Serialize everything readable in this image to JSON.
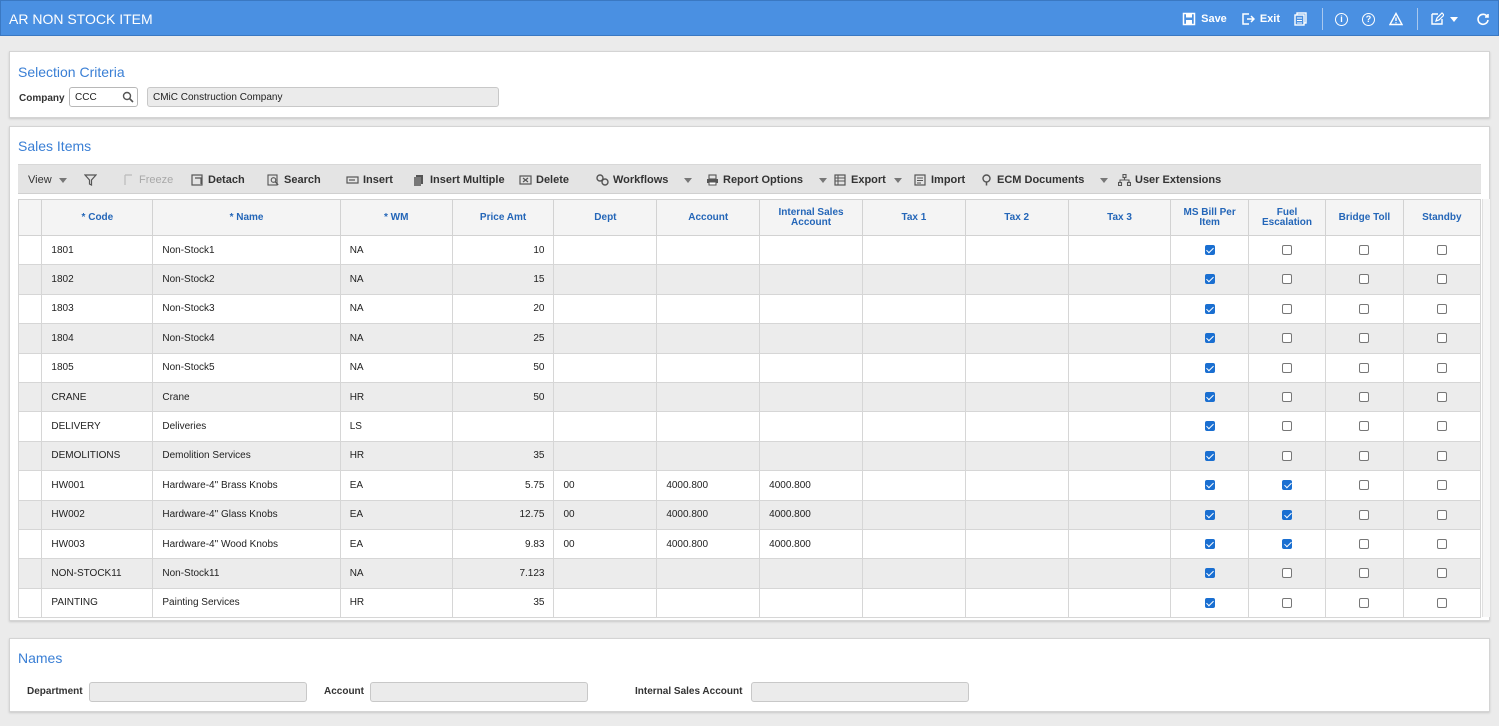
{
  "window": {
    "title": "AR NON STOCK ITEM"
  },
  "titlebar": {
    "save_label": "Save",
    "exit_label": "Exit"
  },
  "selection_criteria": {
    "title": "Selection Criteria",
    "company_label": "Company",
    "company_value": "CCC",
    "company_name": "CMiC Construction Company"
  },
  "sales_items": {
    "title": "Sales Items",
    "toolbar": {
      "view": "View",
      "freeze": "Freeze",
      "detach": "Detach",
      "search": "Search",
      "insert": "Insert",
      "insert_multiple": "Insert Multiple",
      "delete": "Delete",
      "workflows": "Workflows",
      "report_options": "Report Options",
      "export": "Export",
      "import": "Import",
      "ecm_documents": "ECM Documents",
      "user_extensions": "User Extensions"
    },
    "columns": {
      "code": "* Code",
      "name": "* Name",
      "wm": "* WM",
      "price_amt": "Price Amt",
      "dept": "Dept",
      "account": "Account",
      "internal_sales_account": "Internal Sales Account",
      "tax1": "Tax 1",
      "tax2": "Tax 2",
      "tax3": "Tax 3",
      "ms_bill_per_item": "MS Bill Per Item",
      "fuel_escalation": "Fuel Escalation",
      "bridge_toll": "Bridge Toll",
      "standby": "Standby"
    },
    "rows": [
      {
        "code": "1801",
        "name": "Non-Stock1",
        "wm": "NA",
        "price": "10",
        "dept": "",
        "account": "",
        "isa": "",
        "tax1": "",
        "tax2": "",
        "tax3": "",
        "ms": true,
        "fuel": false,
        "bridge": false,
        "standby": false
      },
      {
        "code": "1802",
        "name": "Non-Stock2",
        "wm": "NA",
        "price": "15",
        "dept": "",
        "account": "",
        "isa": "",
        "tax1": "",
        "tax2": "",
        "tax3": "",
        "ms": true,
        "fuel": false,
        "bridge": false,
        "standby": false
      },
      {
        "code": "1803",
        "name": "Non-Stock3",
        "wm": "NA",
        "price": "20",
        "dept": "",
        "account": "",
        "isa": "",
        "tax1": "",
        "tax2": "",
        "tax3": "",
        "ms": true,
        "fuel": false,
        "bridge": false,
        "standby": false
      },
      {
        "code": "1804",
        "name": "Non-Stock4",
        "wm": "NA",
        "price": "25",
        "dept": "",
        "account": "",
        "isa": "",
        "tax1": "",
        "tax2": "",
        "tax3": "",
        "ms": true,
        "fuel": false,
        "bridge": false,
        "standby": false
      },
      {
        "code": "1805",
        "name": "Non-Stock5",
        "wm": "NA",
        "price": "50",
        "dept": "",
        "account": "",
        "isa": "",
        "tax1": "",
        "tax2": "",
        "tax3": "",
        "ms": true,
        "fuel": false,
        "bridge": false,
        "standby": false
      },
      {
        "code": "CRANE",
        "name": "Crane",
        "wm": "HR",
        "price": "50",
        "dept": "",
        "account": "",
        "isa": "",
        "tax1": "",
        "tax2": "",
        "tax3": "",
        "ms": true,
        "fuel": false,
        "bridge": false,
        "standby": false
      },
      {
        "code": "DELIVERY",
        "name": "Deliveries",
        "wm": "LS",
        "price": "",
        "dept": "",
        "account": "",
        "isa": "",
        "tax1": "",
        "tax2": "",
        "tax3": "",
        "ms": true,
        "fuel": false,
        "bridge": false,
        "standby": false
      },
      {
        "code": "DEMOLITIONS",
        "name": "Demolition Services",
        "wm": "HR",
        "price": "35",
        "dept": "",
        "account": "",
        "isa": "",
        "tax1": "",
        "tax2": "",
        "tax3": "",
        "ms": true,
        "fuel": false,
        "bridge": false,
        "standby": false
      },
      {
        "code": "HW001",
        "name": "Hardware-4\" Brass Knobs",
        "wm": "EA",
        "price": "5.75",
        "dept": "00",
        "account": "4000.800",
        "isa": "4000.800",
        "tax1": "",
        "tax2": "",
        "tax3": "",
        "ms": true,
        "fuel": true,
        "bridge": false,
        "standby": false
      },
      {
        "code": "HW002",
        "name": "Hardware-4\" Glass Knobs",
        "wm": "EA",
        "price": "12.75",
        "dept": "00",
        "account": "4000.800",
        "isa": "4000.800",
        "tax1": "",
        "tax2": "",
        "tax3": "",
        "ms": true,
        "fuel": true,
        "bridge": false,
        "standby": false
      },
      {
        "code": "HW003",
        "name": "Hardware-4\" Wood Knobs",
        "wm": "EA",
        "price": "9.83",
        "dept": "00",
        "account": "4000.800",
        "isa": "4000.800",
        "tax1": "",
        "tax2": "",
        "tax3": "",
        "ms": true,
        "fuel": true,
        "bridge": false,
        "standby": false
      },
      {
        "code": "NON-STOCK11",
        "name": "Non-Stock11",
        "wm": "NA",
        "price": "7.123",
        "dept": "",
        "account": "",
        "isa": "",
        "tax1": "",
        "tax2": "",
        "tax3": "",
        "ms": true,
        "fuel": false,
        "bridge": false,
        "standby": false
      },
      {
        "code": "PAINTING",
        "name": "Painting Services",
        "wm": "HR",
        "price": "35",
        "dept": "",
        "account": "",
        "isa": "",
        "tax1": "",
        "tax2": "",
        "tax3": "",
        "ms": true,
        "fuel": false,
        "bridge": false,
        "standby": false
      }
    ]
  },
  "names": {
    "title": "Names",
    "department_label": "Department",
    "department_value": "",
    "account_label": "Account",
    "account_value": "",
    "isa_label": "Internal Sales Account",
    "isa_value": ""
  },
  "colors": {
    "title_bar": "#4a90e2",
    "section_title": "#3a7fd5",
    "column_header": "#2466b8",
    "checkbox_checked": "#1a6fd1"
  },
  "icons": [
    "save-icon",
    "exit-icon",
    "print-icon",
    "info-icon",
    "help-icon",
    "warning-icon",
    "edit-icon",
    "refresh-icon",
    "search-icon",
    "filter-icon",
    "freeze-icon",
    "detach-icon",
    "insert-icon",
    "insert-multiple-icon",
    "delete-icon",
    "workflows-icon",
    "report-icon",
    "export-icon",
    "import-icon",
    "ecm-icon",
    "user-extensions-icon"
  ]
}
